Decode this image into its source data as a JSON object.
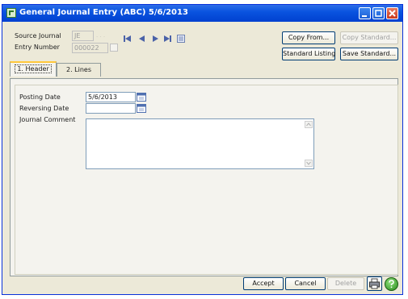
{
  "window": {
    "title": "General Journal Entry (ABC) 5/6/2013"
  },
  "header": {
    "source_journal_label": "Source Journal",
    "source_journal_value": "JE",
    "entry_number_label": "Entry Number",
    "entry_number_value": "000022"
  },
  "toolbar": {
    "copy_from": "Copy From...",
    "copy_standard": "Copy Standard...",
    "standard_listing": "Standard Listing",
    "save_standard": "Save Standard..."
  },
  "tabs": [
    {
      "label": "1. Header"
    },
    {
      "label": "2. Lines"
    }
  ],
  "form": {
    "posting_date_label": "Posting Date",
    "posting_date_value": "5/6/2013",
    "reversing_date_label": "Reversing Date",
    "reversing_date_value": "",
    "journal_comment_label": "Journal Comment"
  },
  "footer": {
    "accept": "Accept",
    "cancel": "Cancel",
    "delete": "Delete"
  },
  "colors": {
    "titlebar": "#0a54e0",
    "window_bg": "#ece9d8"
  },
  "icons": [
    "app-icon",
    "first-record-icon",
    "previous-record-icon",
    "next-record-icon",
    "last-record-icon",
    "lookup-list-icon",
    "calendar-icon",
    "print-icon",
    "help-icon"
  ]
}
